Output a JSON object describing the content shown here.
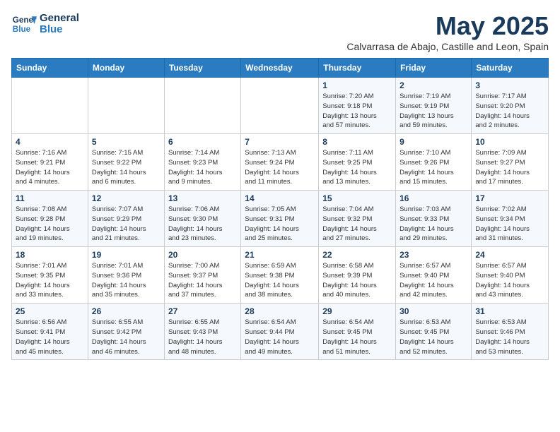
{
  "logo": {
    "line1": "General",
    "line2": "Blue"
  },
  "title": "May 2025",
  "subtitle": "Calvarrasa de Abajo, Castille and Leon, Spain",
  "weekdays": [
    "Sunday",
    "Monday",
    "Tuesday",
    "Wednesday",
    "Thursday",
    "Friday",
    "Saturday"
  ],
  "weeks": [
    [
      {
        "day": "",
        "info": ""
      },
      {
        "day": "",
        "info": ""
      },
      {
        "day": "",
        "info": ""
      },
      {
        "day": "",
        "info": ""
      },
      {
        "day": "1",
        "info": "Sunrise: 7:20 AM\nSunset: 9:18 PM\nDaylight: 13 hours\nand 57 minutes."
      },
      {
        "day": "2",
        "info": "Sunrise: 7:19 AM\nSunset: 9:19 PM\nDaylight: 13 hours\nand 59 minutes."
      },
      {
        "day": "3",
        "info": "Sunrise: 7:17 AM\nSunset: 9:20 PM\nDaylight: 14 hours\nand 2 minutes."
      }
    ],
    [
      {
        "day": "4",
        "info": "Sunrise: 7:16 AM\nSunset: 9:21 PM\nDaylight: 14 hours\nand 4 minutes."
      },
      {
        "day": "5",
        "info": "Sunrise: 7:15 AM\nSunset: 9:22 PM\nDaylight: 14 hours\nand 6 minutes."
      },
      {
        "day": "6",
        "info": "Sunrise: 7:14 AM\nSunset: 9:23 PM\nDaylight: 14 hours\nand 9 minutes."
      },
      {
        "day": "7",
        "info": "Sunrise: 7:13 AM\nSunset: 9:24 PM\nDaylight: 14 hours\nand 11 minutes."
      },
      {
        "day": "8",
        "info": "Sunrise: 7:11 AM\nSunset: 9:25 PM\nDaylight: 14 hours\nand 13 minutes."
      },
      {
        "day": "9",
        "info": "Sunrise: 7:10 AM\nSunset: 9:26 PM\nDaylight: 14 hours\nand 15 minutes."
      },
      {
        "day": "10",
        "info": "Sunrise: 7:09 AM\nSunset: 9:27 PM\nDaylight: 14 hours\nand 17 minutes."
      }
    ],
    [
      {
        "day": "11",
        "info": "Sunrise: 7:08 AM\nSunset: 9:28 PM\nDaylight: 14 hours\nand 19 minutes."
      },
      {
        "day": "12",
        "info": "Sunrise: 7:07 AM\nSunset: 9:29 PM\nDaylight: 14 hours\nand 21 minutes."
      },
      {
        "day": "13",
        "info": "Sunrise: 7:06 AM\nSunset: 9:30 PM\nDaylight: 14 hours\nand 23 minutes."
      },
      {
        "day": "14",
        "info": "Sunrise: 7:05 AM\nSunset: 9:31 PM\nDaylight: 14 hours\nand 25 minutes."
      },
      {
        "day": "15",
        "info": "Sunrise: 7:04 AM\nSunset: 9:32 PM\nDaylight: 14 hours\nand 27 minutes."
      },
      {
        "day": "16",
        "info": "Sunrise: 7:03 AM\nSunset: 9:33 PM\nDaylight: 14 hours\nand 29 minutes."
      },
      {
        "day": "17",
        "info": "Sunrise: 7:02 AM\nSunset: 9:34 PM\nDaylight: 14 hours\nand 31 minutes."
      }
    ],
    [
      {
        "day": "18",
        "info": "Sunrise: 7:01 AM\nSunset: 9:35 PM\nDaylight: 14 hours\nand 33 minutes."
      },
      {
        "day": "19",
        "info": "Sunrise: 7:01 AM\nSunset: 9:36 PM\nDaylight: 14 hours\nand 35 minutes."
      },
      {
        "day": "20",
        "info": "Sunrise: 7:00 AM\nSunset: 9:37 PM\nDaylight: 14 hours\nand 37 minutes."
      },
      {
        "day": "21",
        "info": "Sunrise: 6:59 AM\nSunset: 9:38 PM\nDaylight: 14 hours\nand 38 minutes."
      },
      {
        "day": "22",
        "info": "Sunrise: 6:58 AM\nSunset: 9:39 PM\nDaylight: 14 hours\nand 40 minutes."
      },
      {
        "day": "23",
        "info": "Sunrise: 6:57 AM\nSunset: 9:40 PM\nDaylight: 14 hours\nand 42 minutes."
      },
      {
        "day": "24",
        "info": "Sunrise: 6:57 AM\nSunset: 9:40 PM\nDaylight: 14 hours\nand 43 minutes."
      }
    ],
    [
      {
        "day": "25",
        "info": "Sunrise: 6:56 AM\nSunset: 9:41 PM\nDaylight: 14 hours\nand 45 minutes."
      },
      {
        "day": "26",
        "info": "Sunrise: 6:55 AM\nSunset: 9:42 PM\nDaylight: 14 hours\nand 46 minutes."
      },
      {
        "day": "27",
        "info": "Sunrise: 6:55 AM\nSunset: 9:43 PM\nDaylight: 14 hours\nand 48 minutes."
      },
      {
        "day": "28",
        "info": "Sunrise: 6:54 AM\nSunset: 9:44 PM\nDaylight: 14 hours\nand 49 minutes."
      },
      {
        "day": "29",
        "info": "Sunrise: 6:54 AM\nSunset: 9:45 PM\nDaylight: 14 hours\nand 51 minutes."
      },
      {
        "day": "30",
        "info": "Sunrise: 6:53 AM\nSunset: 9:45 PM\nDaylight: 14 hours\nand 52 minutes."
      },
      {
        "day": "31",
        "info": "Sunrise: 6:53 AM\nSunset: 9:46 PM\nDaylight: 14 hours\nand 53 minutes."
      }
    ]
  ]
}
